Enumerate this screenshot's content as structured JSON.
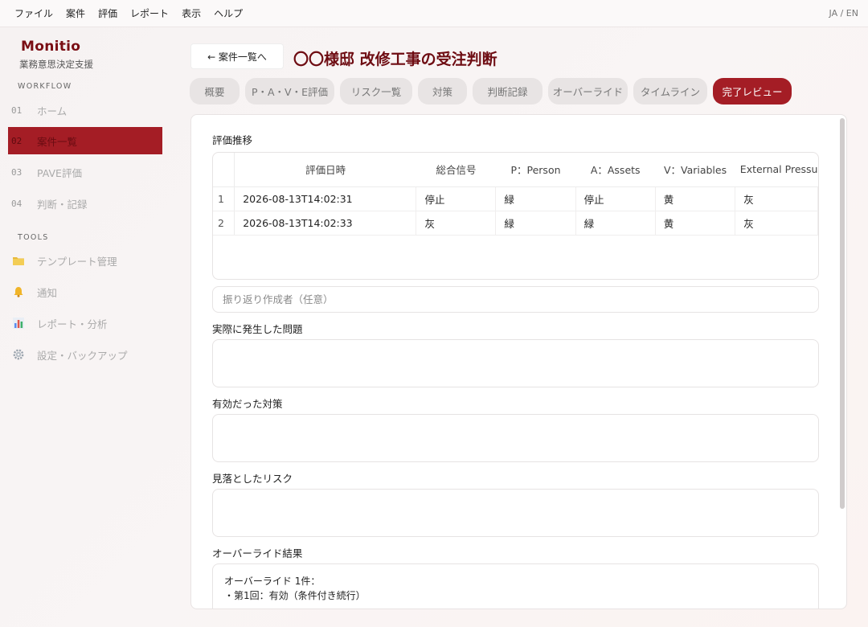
{
  "menubar": {
    "items": [
      "ファイル",
      "案件",
      "評価",
      "レポート",
      "表示",
      "ヘルプ"
    ],
    "lang": "JA / EN"
  },
  "sidebar": {
    "brand": "Monitio",
    "brand_sub": "業務意思決定支援",
    "workflow_label": "WORKFLOW",
    "workflow_items": [
      {
        "num": "01",
        "label": "ホーム"
      },
      {
        "num": "02",
        "label": "案件一覧"
      },
      {
        "num": "03",
        "label": "PAVE評価"
      },
      {
        "num": "04",
        "label": "判断・記録"
      }
    ],
    "tools_label": "TOOLS",
    "tools_items": [
      {
        "icon": "folder-icon",
        "label": "テンプレート管理"
      },
      {
        "icon": "bell-icon",
        "label": "通知"
      },
      {
        "icon": "bar-chart-icon",
        "label": "レポート・分析"
      },
      {
        "icon": "gear-icon",
        "label": "設定・バックアップ"
      }
    ]
  },
  "header": {
    "back_label": "← 案件一覧へ",
    "title": "〇〇様邸 改修工事の受注判断"
  },
  "tabs": [
    "概要",
    "P・A・V・E評価",
    "リスク一覧",
    "対策",
    "判断記録",
    "オーバーライド",
    "タイムライン",
    "完了レビュー"
  ],
  "active_tab": "完了レビュー",
  "review": {
    "history_label": "評価推移",
    "table": {
      "columns": [
        "",
        "評価日時",
        "総合信号",
        "P：Person",
        "A：Assets",
        "V：Variables",
        "External Pressu"
      ],
      "rows": [
        [
          "1",
          "2026-08-13T14:02:31",
          "停止",
          "緑",
          "停止",
          "黄",
          "灰"
        ],
        [
          "2",
          "2026-08-13T14:02:33",
          "灰",
          "緑",
          "緑",
          "黄",
          "灰"
        ]
      ]
    },
    "author_placeholder": "振り返り作成者（任意）",
    "problems_label": "実際に発生した問題",
    "effective_label": "有効だった対策",
    "missed_label": "見落としたリスク",
    "override_label": "オーバーライド結果",
    "override_line1": "オーバーライド 1件：",
    "override_line2": "・第1回：有効（条件付き続行）"
  },
  "colors": {
    "accent": "#a41d25",
    "brand": "#7a0e14"
  }
}
